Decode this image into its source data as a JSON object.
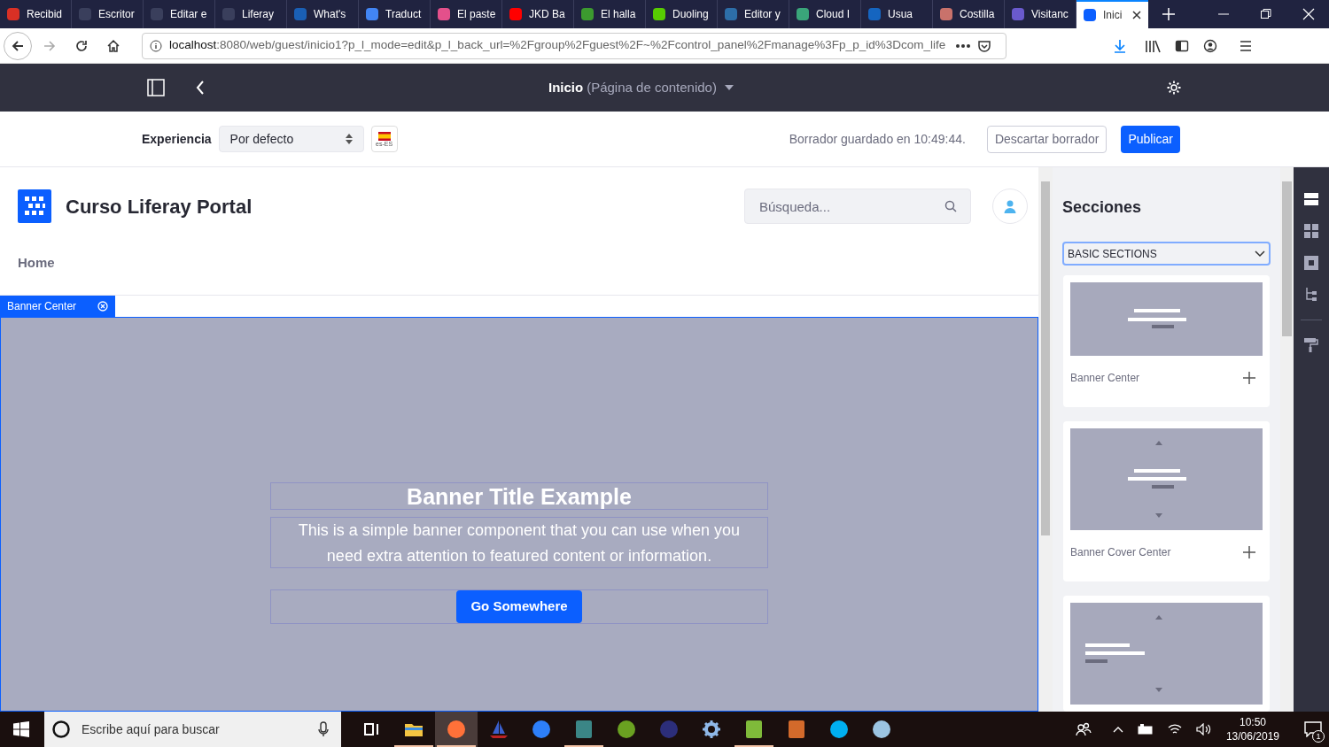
{
  "browser": {
    "tabs": [
      {
        "label": "Recibid",
        "color": "#d93025",
        "selected": false
      },
      {
        "label": "Escritor",
        "color": "#3a3f5c",
        "selected": false
      },
      {
        "label": "Editar e",
        "color": "#3a3f5c",
        "selected": false
      },
      {
        "label": "Liferay",
        "color": "#3a3f5c",
        "selected": false
      },
      {
        "label": "What's",
        "color": "#1a5fb4",
        "selected": false
      },
      {
        "label": "Traduct",
        "color": "#4285f4",
        "selected": false
      },
      {
        "label": "El paste",
        "color": "#e4508b",
        "selected": false
      },
      {
        "label": "JKD Ba",
        "color": "#ff0000",
        "selected": false
      },
      {
        "label": "El halla",
        "color": "#3c9a2f",
        "selected": false
      },
      {
        "label": "Duoling",
        "color": "#58cc02",
        "selected": false
      },
      {
        "label": "Editor y",
        "color": "#2d6ea8",
        "selected": false
      },
      {
        "label": "Cloud I",
        "color": "#3aa57a",
        "selected": false
      },
      {
        "label": "Usua",
        "color": "#1565c0",
        "selected": false
      },
      {
        "label": "Costilla",
        "color": "#c9726b",
        "selected": false
      },
      {
        "label": "Visitanc",
        "color": "#6a5acd",
        "selected": false
      },
      {
        "label": "Inici",
        "color": "#0b5fff",
        "selected": true
      }
    ],
    "url_host": "localhost",
    "url_rest": ":8080/web/guest/inicio1?p_l_mode=edit&p_l_back_url=%2Fgroup%2Fguest%2F~%2Fcontrol_panel%2Fmanage%3Fp_p_id%3Dcom_life"
  },
  "editor_bar": {
    "title": "Inicio",
    "subtitle": "(Página de contenido)"
  },
  "toolbar": {
    "experience_label": "Experiencia",
    "experience_value": "Por defecto",
    "language": "es-ES",
    "status": "Borrador guardado en 10:49:44.",
    "discard": "Descartar borrador",
    "publish": "Publicar"
  },
  "site": {
    "name": "Curso Liferay Portal",
    "search_placeholder": "Búsqueda...",
    "nav": [
      "Home"
    ]
  },
  "fragment": {
    "label": "Banner Center",
    "title": "Banner Title Example",
    "text": "This is a simple banner component that you can use when you need extra attention to featured content or information.",
    "button": "Go Somewhere"
  },
  "sidebar": {
    "title": "Secciones",
    "collection": "BASIC SECTIONS",
    "sections": [
      {
        "label": "Banner Center",
        "kind": "center"
      },
      {
        "label": "Banner Cover Center",
        "kind": "cover"
      },
      {
        "kind": "left"
      }
    ],
    "rail": [
      {
        "kind": "sections",
        "selected": true
      },
      {
        "kind": "widgets",
        "selected": false
      },
      {
        "kind": "fragment",
        "selected": false
      },
      {
        "kind": "tree",
        "selected": false
      },
      {
        "kind": "paint",
        "selected": false
      }
    ]
  },
  "taskbar": {
    "search_placeholder": "Escribe aquí para buscar",
    "apps": [
      {
        "kind": "taskview",
        "color": "#ffffff",
        "running": false,
        "selected": false
      },
      {
        "kind": "folder",
        "color": "#f4c542",
        "running": true,
        "selected": false
      },
      {
        "kind": "circle",
        "color": "#ff7139",
        "running": true,
        "selected": true
      },
      {
        "kind": "sail",
        "color": "#3a5fcd",
        "running": false,
        "selected": false
      },
      {
        "kind": "circle",
        "color": "#2d7ff9",
        "running": false,
        "selected": false
      },
      {
        "kind": "square",
        "color": "#3b8686",
        "running": true,
        "selected": false
      },
      {
        "kind": "circle",
        "color": "#6aa121",
        "running": false,
        "selected": false
      },
      {
        "kind": "circle",
        "color": "#2c2e7a",
        "running": false,
        "selected": false
      },
      {
        "kind": "gear",
        "color": "#8fb8e8",
        "running": false,
        "selected": false
      },
      {
        "kind": "square",
        "color": "#7fba3a",
        "running": true,
        "selected": false
      },
      {
        "kind": "square",
        "color": "#d36a2b",
        "running": false,
        "selected": false
      },
      {
        "kind": "circle",
        "color": "#00aff0",
        "running": false,
        "selected": false
      },
      {
        "kind": "circle",
        "color": "#9bc4e2",
        "running": false,
        "selected": false
      }
    ],
    "time": "10:50",
    "date": "13/06/2019",
    "notifications": "1"
  }
}
